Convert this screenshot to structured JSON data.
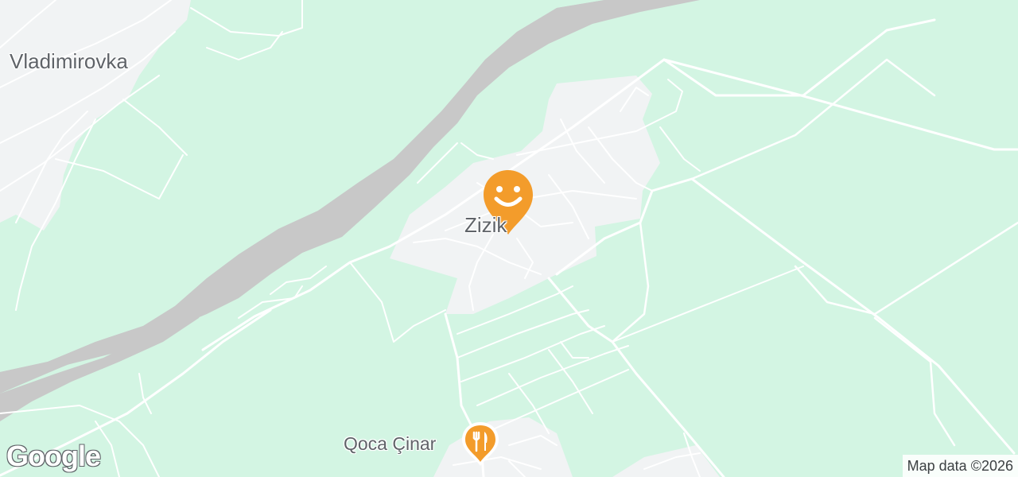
{
  "map": {
    "labels": {
      "vladimirovka": "Vladimirovka",
      "zizik": "Zizik",
      "qoca_cinar": "Qoca Çinar"
    },
    "markers": {
      "place": {
        "icon": "smiley-face-icon",
        "color": "#f39c2b"
      },
      "restaurant": {
        "icon": "fork-knife-icon",
        "color": "#f39c2b"
      }
    },
    "attribution": "Map data ©2026",
    "logo": "Google",
    "colors": {
      "land": "#d3f5e3",
      "river": "#c8c8c8",
      "settlement": "#f1f3f4",
      "road": "#ffffff"
    }
  }
}
